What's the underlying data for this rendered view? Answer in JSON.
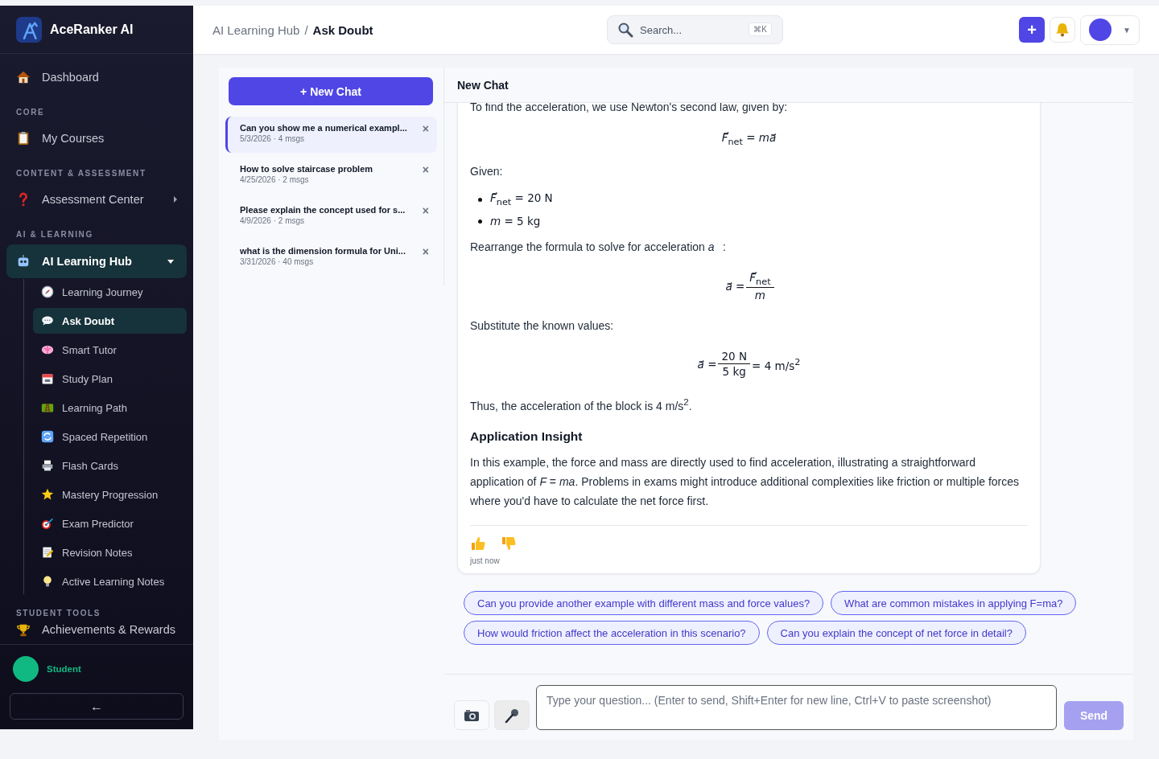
{
  "brand": {
    "name": "AceRanker AI"
  },
  "sidebar": {
    "items": [
      {
        "kind": "link",
        "label": "Dashboard"
      },
      {
        "kind": "section",
        "label": "CORE"
      },
      {
        "kind": "link",
        "label": "My Courses"
      },
      {
        "kind": "section",
        "label": "CONTENT & ASSESSMENT"
      },
      {
        "kind": "group",
        "label": "Assessment Center",
        "expanded": false
      },
      {
        "kind": "section",
        "label": "AI & LEARNING"
      },
      {
        "kind": "group",
        "label": "AI Learning Hub",
        "expanded": true,
        "children": [
          {
            "label": "Learning Journey",
            "selected": false
          },
          {
            "label": "Ask Doubt",
            "selected": true
          },
          {
            "label": "Smart Tutor",
            "selected": false
          },
          {
            "label": "Study Plan",
            "selected": false
          },
          {
            "label": "Learning Path",
            "selected": false
          },
          {
            "label": "Spaced Repetition",
            "selected": false
          },
          {
            "label": "Flash Cards",
            "selected": false
          },
          {
            "label": "Mastery Progression",
            "selected": false
          },
          {
            "label": "Exam Predictor",
            "selected": false
          },
          {
            "label": "Revision Notes",
            "selected": false
          },
          {
            "label": "Active Learning Notes",
            "selected": false
          }
        ]
      },
      {
        "kind": "section",
        "label": "STUDENT TOOLS"
      },
      {
        "kind": "link",
        "label": "Achievements & Rewards"
      }
    ]
  },
  "user": {
    "role": "Student"
  },
  "back_button": "←",
  "header": {
    "breadcrumb": [
      "AI Learning Hub",
      "Ask Doubt"
    ],
    "separator": "/",
    "search": {
      "placeholder": "Search...",
      "shortcut": "⌘K"
    },
    "add_button": "+",
    "profile_caret": "▼"
  },
  "chat_list": {
    "new_chat": "+ New Chat",
    "close": "×",
    "conversations": [
      {
        "title": "Can you show me a numerical exampl...",
        "meta": "5/3/2026 · 4 msgs",
        "selected": true
      },
      {
        "title": "How to solve staircase problem",
        "meta": "4/25/2026 · 2 msgs",
        "selected": false
      },
      {
        "title": "Please explain the concept used for s...",
        "meta": "4/9/2026 · 2 msgs",
        "selected": false
      },
      {
        "title": "what is the dimension formula for Uni...",
        "meta": "3/31/2026 · 40 msgs",
        "selected": false
      }
    ]
  },
  "chat": {
    "title": "New Chat",
    "message": {
      "blocks": [
        {
          "kind": "paragraph",
          "text": "To find the acceleration, we use Newton's second law, given by:"
        },
        {
          "kind": "formula",
          "text": "*F⃗*$_{net}$ = *ma⃗*"
        },
        {
          "kind": "paragraph",
          "text": "Given:"
        },
        {
          "kind": "list",
          "items": [
            "*F⃗*$_{net}$ = 20 N",
            "*m* = 5 kg"
          ]
        },
        {
          "kind": "paragraph",
          "text": "Rearrange the formula to solve for acceleration *a⃗*:"
        },
        {
          "kind": "fraction",
          "lhs": "*a⃗* =",
          "numerator": "*F⃗*$_{net}$",
          "denominator": "*m*"
        },
        {
          "kind": "paragraph",
          "text": "Substitute the known values:"
        },
        {
          "kind": "fraction",
          "lhs": "*a⃗* =",
          "numerator": "20 N",
          "denominator": "5 kg",
          "rhs": "= 4 m/s$^{2}$"
        },
        {
          "kind": "paragraph",
          "text": "Thus, the acceleration of the block is 4 m/s$^{2}$."
        },
        {
          "kind": "heading",
          "text": "Application Insight"
        },
        {
          "kind": "paragraph",
          "text": "In this example, the force and mass are directly used to find acceleration, illustrating a straightforward application of *F* = *ma*. Problems in exams might introduce additional complexities like friction or multiple forces where you'd have to calculate the net force first."
        }
      ],
      "time": "just now"
    },
    "suggestions": [
      "Can you provide another example with different mass and force values?",
      "What are common mistakes in applying F=ma?",
      "How would friction affect the acceleration in this scenario?",
      "Can you explain the concept of net force in detail?"
    ],
    "input": {
      "placeholder": "Type your question... (Enter to send, Shift+Enter for new line, Ctrl+V to paste screenshot)"
    },
    "send": {
      "label": "Send",
      "disabled": true
    }
  }
}
